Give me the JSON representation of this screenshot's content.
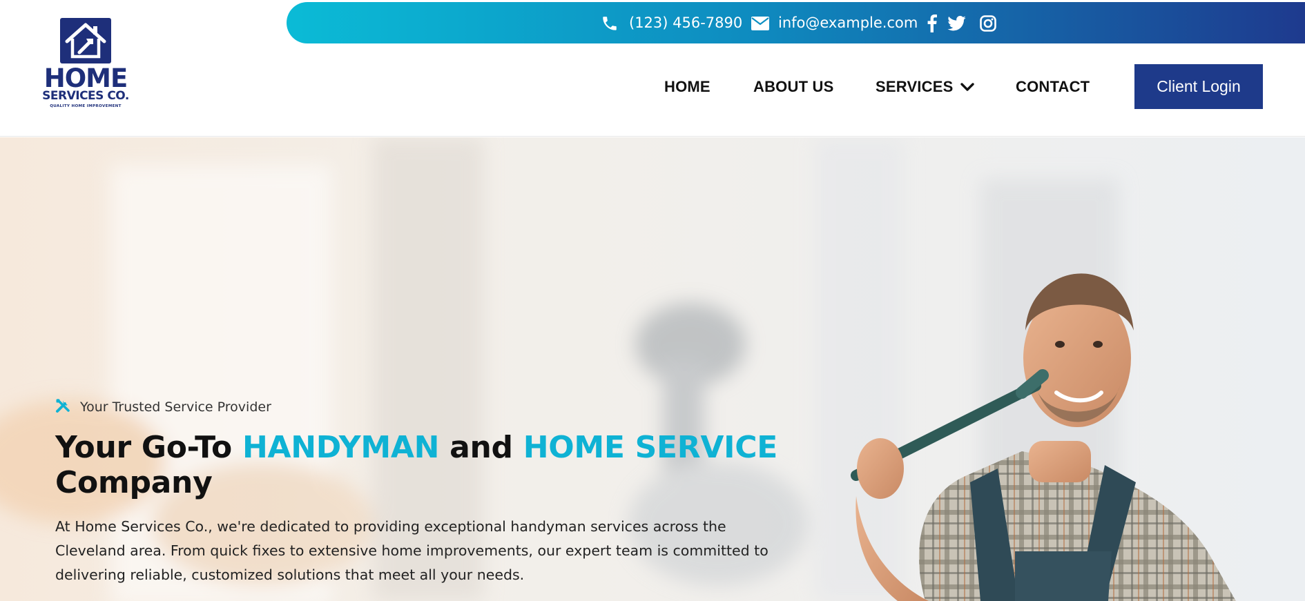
{
  "brand": {
    "name": "HOME",
    "subtitle": "SERVICES CO.",
    "tagline": "QUALITY HOME IMPROVEMENT",
    "colors": {
      "navy": "#1e2f7a",
      "accent": "#0fb2d4"
    }
  },
  "topbar": {
    "phone": "(123) 456-7890",
    "email": "info@example.com",
    "social_icons": [
      "facebook-icon",
      "twitter-icon",
      "instagram-icon"
    ],
    "gradient": [
      "#0bbbd6",
      "#1e3a8e"
    ]
  },
  "nav": {
    "items": [
      {
        "label": "HOME"
      },
      {
        "label": "ABOUT US"
      },
      {
        "label": "SERVICES"
      },
      {
        "label": "CONTACT"
      }
    ],
    "login_label": "Client Login"
  },
  "hero": {
    "eyebrow": "Your Trusted Service Provider",
    "headline": {
      "part1": "Your Go-To ",
      "accent1": "HANDYMAN",
      "part2": " and ",
      "accent2": "HOME SERVICE",
      "part3": "Company"
    },
    "description": "At Home Services Co., we're dedicated to providing exceptional handyman services across the Cleveland area. From quick fixes to extensive home improvements, our expert team is committed to delivering reliable, customized solutions that meet all your needs."
  }
}
